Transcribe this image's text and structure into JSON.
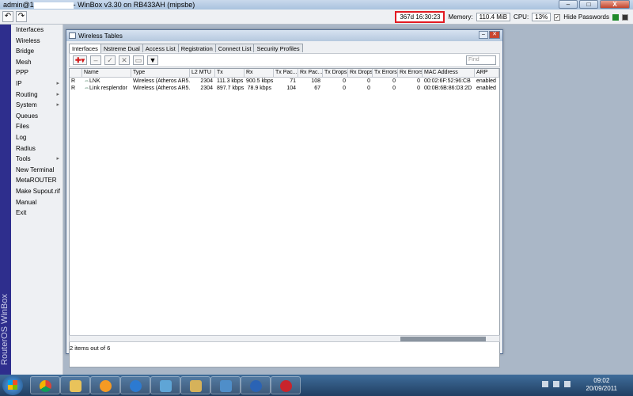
{
  "window": {
    "title_user": "admin@1",
    "title_app": "- WinBox v3.30 on RB433AH (mipsbe)"
  },
  "toolbar": {
    "undo_glyph": "↶",
    "redo_glyph": "↷",
    "uptime": "367d 16:30:23",
    "memory_label": "Memory:",
    "memory_value": "110.4 MiB",
    "cpu_label": "CPU:",
    "cpu_value": "13%",
    "hide_passwords": "Hide Passwords",
    "hide_passwords_checked": true
  },
  "sidebar": {
    "vertical_label": "RouterOS WinBox",
    "items": [
      {
        "label": "Interfaces",
        "arrow": ""
      },
      {
        "label": "Wireless",
        "arrow": ""
      },
      {
        "label": "Bridge",
        "arrow": ""
      },
      {
        "label": "Mesh",
        "arrow": ""
      },
      {
        "label": "PPP",
        "arrow": ""
      },
      {
        "label": "IP",
        "arrow": "▸"
      },
      {
        "label": "Routing",
        "arrow": "▸"
      },
      {
        "label": "System",
        "arrow": "▸"
      },
      {
        "label": "Queues",
        "arrow": ""
      },
      {
        "label": "Files",
        "arrow": ""
      },
      {
        "label": "Log",
        "arrow": ""
      },
      {
        "label": "Radius",
        "arrow": ""
      },
      {
        "label": "Tools",
        "arrow": "▸"
      },
      {
        "label": "New Terminal",
        "arrow": ""
      },
      {
        "label": "MetaROUTER",
        "arrow": ""
      },
      {
        "label": "Make Supout.rif",
        "arrow": ""
      },
      {
        "label": "Manual",
        "arrow": ""
      },
      {
        "label": "Exit",
        "arrow": ""
      }
    ]
  },
  "wireless": {
    "title": "Wireless Tables",
    "tabs": [
      "Interfaces",
      "Nstreme Dual",
      "Access List",
      "Registration",
      "Connect List",
      "Security Profiles"
    ],
    "find_placeholder": "Find",
    "columns": [
      "",
      "Name",
      "Type",
      "L2 MTU",
      "Tx",
      "Rx",
      "Tx Pac...",
      "Rx Pac...",
      "Tx Drops",
      "Rx Drops",
      "Tx Errors",
      "Rx Errors",
      "MAC Address",
      "ARP"
    ],
    "rows": [
      {
        "flag": "R",
        "name": "LNK",
        "type": "Wireless (Atheros AR5...",
        "mtu": "2304",
        "tx": "111.3 kbps",
        "rx": "900.5 kbps",
        "txp": "71",
        "rxp": "108",
        "txd": "0",
        "rxd": "0",
        "txe": "0",
        "rxe": "0",
        "mac": "00:02:6F:52:96:CB",
        "arp": "enabled"
      },
      {
        "flag": "R",
        "name": "Link resplendor",
        "type": "Wireless (Atheros AR5...",
        "mtu": "2304",
        "tx": "897.7 kbps",
        "rx": "78.9 kbps",
        "txp": "104",
        "rxp": "67",
        "txd": "0",
        "rxd": "0",
        "txe": "0",
        "rxe": "0",
        "mac": "00:0B:6B:86:D3:2D",
        "arp": "enabled"
      }
    ],
    "status": "2 items out of 6"
  },
  "taskbar": {
    "time": "09:02",
    "date": "20/09/2011",
    "apps": [
      "chrome",
      "explorer",
      "media-player",
      "ie",
      "network",
      "folder",
      "photos",
      "google-earth",
      "winbox"
    ]
  }
}
